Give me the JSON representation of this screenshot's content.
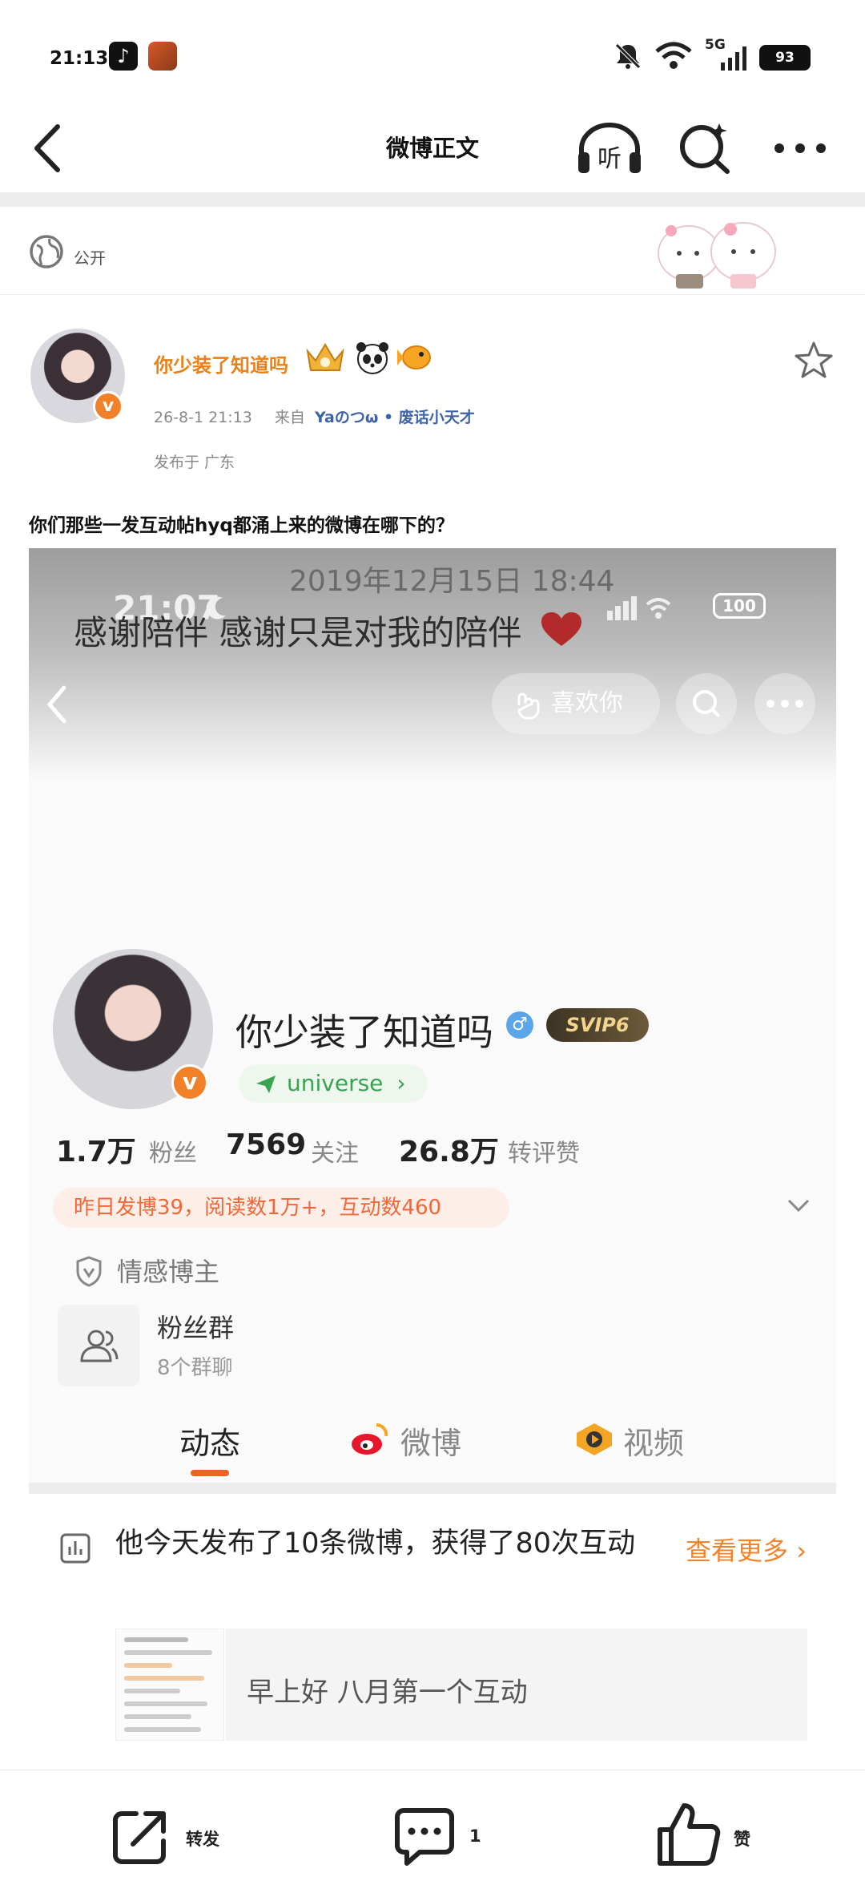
{
  "status_bar": {
    "time": "21:13",
    "network": "5G",
    "battery": "93"
  },
  "header": {
    "title": "微博正文"
  },
  "visibility": {
    "label": "公开"
  },
  "post": {
    "author_name": "你少装了知道吗",
    "date": "26-8-1 21:13",
    "source_prefix": "来自",
    "source_name": "Yaのつω • 废话小天才",
    "location": "发布于 广东",
    "text": "你们那些一发互动帖hyq都涌上来的微博在哪下的？"
  },
  "screenshot": {
    "date": "2019年12月15日 18:44",
    "time": "21:07",
    "battery": "100",
    "caption": "感谢陪伴 感谢只是对我的陪伴",
    "like_button": "喜欢你",
    "profile_name": "你少装了知道吗",
    "vip_badge": "SVIP6",
    "universe_tag": "universe",
    "stats": [
      {
        "num": "1.7万",
        "label": "粉丝"
      },
      {
        "num": "7569",
        "label": "关注"
      },
      {
        "num": "26.8万",
        "label": "转评赞"
      }
    ],
    "activity": "昨日发博39，阅读数1万+，互动数460",
    "tag": "情感博主",
    "fan_group": {
      "title": "粉丝群",
      "sub": "8个群聊"
    },
    "tabs": [
      "动态",
      "微博",
      "视频"
    ]
  },
  "summary": {
    "text": "他今天发布了10条微博，获得了80次互动",
    "more": "查看更多",
    "preview": "早上好 八月第一个互动"
  },
  "bottom_bar": {
    "repost": "转发",
    "comment": "1",
    "like": "赞"
  },
  "colors": {
    "accent": "#f0832b",
    "name": "#e8811a",
    "link": "#3d63a8"
  }
}
